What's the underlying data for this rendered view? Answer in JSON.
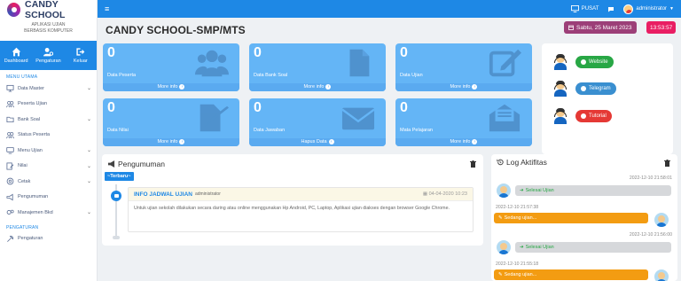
{
  "brand": {
    "name": "CANDY SCHOOL",
    "subtitle_line1": "APLIKASI UJIAN",
    "subtitle_line2": "BERBASIS KOMPUTER"
  },
  "quickbar": [
    {
      "label": "Dashboard",
      "icon": "home-icon"
    },
    {
      "label": "Pengaturan",
      "icon": "user-cog-icon"
    },
    {
      "label": "Keluar",
      "icon": "logout-icon"
    }
  ],
  "sidebar": {
    "header_main": "MENU UTAMA",
    "items": [
      {
        "label": "Data Master",
        "icon": "monitor-icon",
        "chevron": true
      },
      {
        "label": "Peserta Ujian",
        "icon": "users-icon",
        "chevron": false
      },
      {
        "label": "Bank Soal",
        "icon": "folder-icon",
        "chevron": true
      },
      {
        "label": "Status Peserta",
        "icon": "users-status-icon",
        "chevron": false
      },
      {
        "label": "Menu Ujian",
        "icon": "desktop-icon",
        "chevron": true
      },
      {
        "label": "Nilai",
        "icon": "grade-icon",
        "chevron": true
      },
      {
        "label": "Cetak",
        "icon": "print-icon",
        "chevron": true
      },
      {
        "label": "Pengumuman",
        "icon": "megaphone-icon",
        "chevron": false
      },
      {
        "label": "Manajemen Bkd",
        "icon": "gears-icon",
        "chevron": true
      }
    ],
    "header_settings": "PENGATURAN",
    "settings_item": {
      "label": "Pengaturan",
      "icon": "settings-icon"
    }
  },
  "topbar": {
    "pusat": "PUSAT",
    "user": "administrator"
  },
  "page": {
    "title": "CANDY SCHOOL-SMP/MTS",
    "date": "Sabtu, 25 Maret 2023",
    "time": "13:53:57"
  },
  "stats": [
    {
      "value": "0",
      "label": "Data Peserta",
      "footer": "More info",
      "icon": "users-icon"
    },
    {
      "value": "0",
      "label": "Data Bank Soal",
      "footer": "More info",
      "icon": "file-icon"
    },
    {
      "value": "0",
      "label": "Data Ujian",
      "footer": "More info",
      "icon": "edit-icon"
    },
    {
      "value": "0",
      "label": "Data Nilai",
      "footer": "More info",
      "icon": "signature-icon"
    },
    {
      "value": "0",
      "label": "Data Jawaban",
      "footer": "Hapus Data",
      "icon": "envelope-icon"
    },
    {
      "value": "0",
      "label": "Mata Pelajaran",
      "footer": "More info",
      "icon": "envelope-open-icon"
    }
  ],
  "links": [
    {
      "label": "Website",
      "color": "#28a745",
      "icon": "globe-icon"
    },
    {
      "label": "Telegram",
      "color": "#3a8fd0",
      "icon": "telegram-icon"
    },
    {
      "label": "Tutorial",
      "color": "#e53935",
      "icon": "youtube-icon"
    }
  ],
  "announcement": {
    "heading": "Pengumuman",
    "tag": "Terbaru",
    "title": "INFO JADWAL UJIAN",
    "author": "administrator",
    "date": "04-04-2020 10:23",
    "body": "Untuk ujian sekolah dilakukan secara daring atau online menggunakan Hp Android, PC, Laptop, Aplikasi ujian diakses dengan browser Google Chrome."
  },
  "log": {
    "heading": "Log Aktifitas",
    "entries": [
      {
        "time": "2022-12-10 21:58:01",
        "text": "Selesai Ujian",
        "type": "done",
        "side": "left"
      },
      {
        "time": "2022-12-10 21:57:38",
        "text": "Sedang ujian...",
        "type": "ongoing",
        "side": "right"
      },
      {
        "time": "2022-12-10 21:56:00",
        "text": "Selesai Ujian",
        "type": "done",
        "side": "left"
      },
      {
        "time": "2022-12-10 21:55:18",
        "text": "Sedang ujian...",
        "type": "ongoing",
        "side": "right"
      }
    ]
  },
  "colors": {
    "primary": "#1e88e5",
    "stat_bg": "#64b5f6",
    "badge_date": "#9c3f78",
    "badge_time": "#e91e63"
  }
}
